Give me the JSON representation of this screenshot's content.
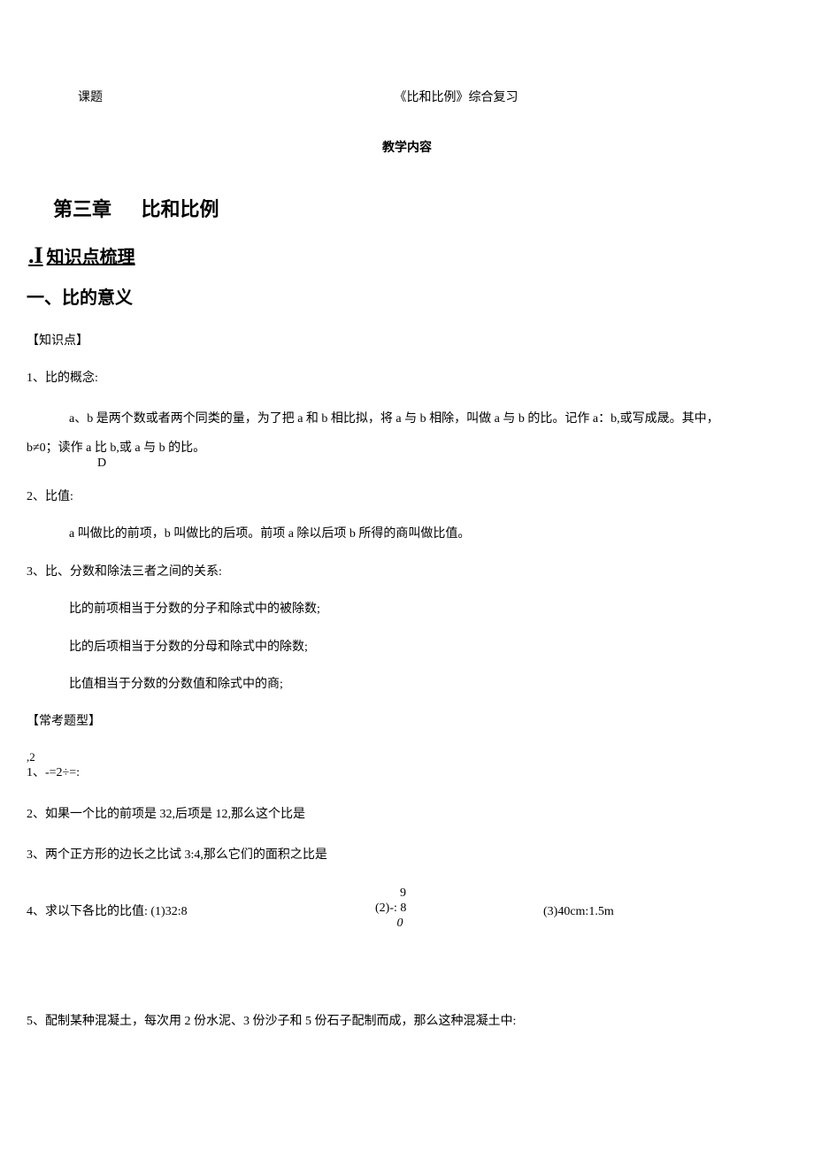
{
  "header": {
    "label": "课题",
    "title": "《比和比例》综合复习"
  },
  "sectionHeading": "教学内容",
  "chapter": {
    "num": "第三章",
    "title": "比和比例"
  },
  "outline": {
    "marker": ".I",
    "text": "知识点梳理"
  },
  "section1Title": "一、比的意义",
  "knowledgeLabel": "【知识点】",
  "k1": {
    "num": "1、比的概念:",
    "body": "a、b 是两个数或者两个同类的量，为了把 a 和 b 相比拟，将 a 与 b 相除，叫做 a 与 b 的比。记作 a：b,或写成晟。其中，",
    "body2": "b≠0；读作 a 比 b,或 a 与 b 的比。",
    "subD": "D"
  },
  "k2": {
    "num": "2、比值:",
    "body": "a 叫做比的前项，b 叫做比的后项。前项 a 除以后项 b 所得的商叫做比值。"
  },
  "k3": {
    "num": "3、比、分数和除法三者之间的关系:",
    "l1": "比的前项相当于分数的分子和除式中的被除数;",
    "l2": "比的后项相当于分数的分母和除式中的除数;",
    "l3": "比值相当于分数的分数值和除式中的商;"
  },
  "examLabel": "【常考题型】",
  "q1": {
    "top": ",2",
    "main": "1、-=2÷=:"
  },
  "q2": "2、如果一个比的前项是 32,后项是 12,那么这个比是",
  "q3": "3、两个正方形的边长之比试 3:4,那么它们的面积之比是",
  "q4": {
    "left": "4、求以下各比的比值: (1)32:8",
    "midTop": "        9",
    "midMain": "(2)-: 8",
    "midBot": "       0",
    "right": "(3)40cm:1.5m"
  },
  "q5": "5、配制某种混凝土，每次用 2 份水泥、3 份沙子和 5 份石子配制而成，那么这种混凝土中:"
}
